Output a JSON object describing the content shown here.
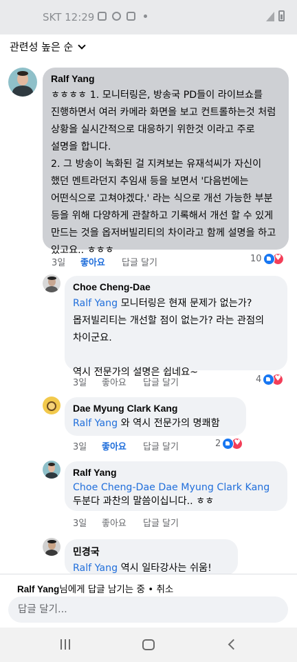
{
  "status_bar": {
    "carrier_time": "SKT 12:29"
  },
  "sort": {
    "label": "관련성 높은 순"
  },
  "comments": [
    {
      "author": "Ralf Yang",
      "text": "ㅎㅎㅎㅎ 1. 모니터링은, 방송국 PD들이 라이브쇼를 진행하면서 여러 카메라 화면을 보고 컨트롤하는것 처럼 상황을 실시간적으로 대응하기 위한것 이라고 주로 설명을 합니다.\n2. 그 방송이 녹화된 걸 지켜보는 유재석씨가 자신이 했던 멘트라던지 추임새 등을 보면서 '다음번에는 어떤식으로 고쳐야겠다.' 라는 식으로 개선 가능한 부분 등을 위해 다양하게 관찰하고 기록해서 개선 할 수 있게 만드는 것을 옵저버빌리티의 차이라고 함께 설명을 하고 있고요.. ㅎㅎㅎ",
      "time": "3일",
      "like": "좋아요",
      "reply": "답글 달기",
      "reactions": "10"
    },
    {
      "author": "Choe Cheng-Dae",
      "tag": "Ralf Yang",
      "text": " 모니터링은 현재 문제가 없는가? 몹저빌리티는 개선할 점이 없는가? 라는 관점의 차이군요.\n\n역시 전문가의 설명은 쉽네요~",
      "time": "3일",
      "like": "좋아요",
      "reply": "답글 달기",
      "reactions": "4"
    },
    {
      "author": "Dae Myung Clark Kang",
      "tag": "Ralf Yang",
      "text": " 와 역시 전문가의 명쾌함",
      "time": "3일",
      "like": "좋아요",
      "reply": "답글 달기",
      "reactions": "2"
    },
    {
      "author": "Ralf Yang",
      "tag": "Choe Cheng-Dae Dae Myung Clark Kang",
      "text": "두분다 과찬의 말씀이십니다.. ㅎㅎ",
      "time": "3일",
      "like": "좋아요",
      "reply": "답글 달기"
    },
    {
      "author": "민경국",
      "tag": "Ralf Yang",
      "text": " 역시 일타강사는 쉬움!"
    }
  ],
  "composer": {
    "replying_name": "Ralf Yang",
    "replying_suffix": "님에게 답글 남기는 중 • ",
    "cancel": "취소",
    "placeholder": "답글 달기..."
  },
  "colors": {
    "link": "#216fdb",
    "bubble": "#f0f2f5",
    "bubble_main": "#ced0d4"
  },
  "icons": [
    "photo-icon",
    "chat-icon",
    "instagram-icon",
    "signal-icon",
    "battery-icon",
    "like-reaction-icon",
    "love-reaction-icon",
    "chevron-down-icon",
    "recent-apps-icon",
    "home-icon",
    "back-icon"
  ]
}
